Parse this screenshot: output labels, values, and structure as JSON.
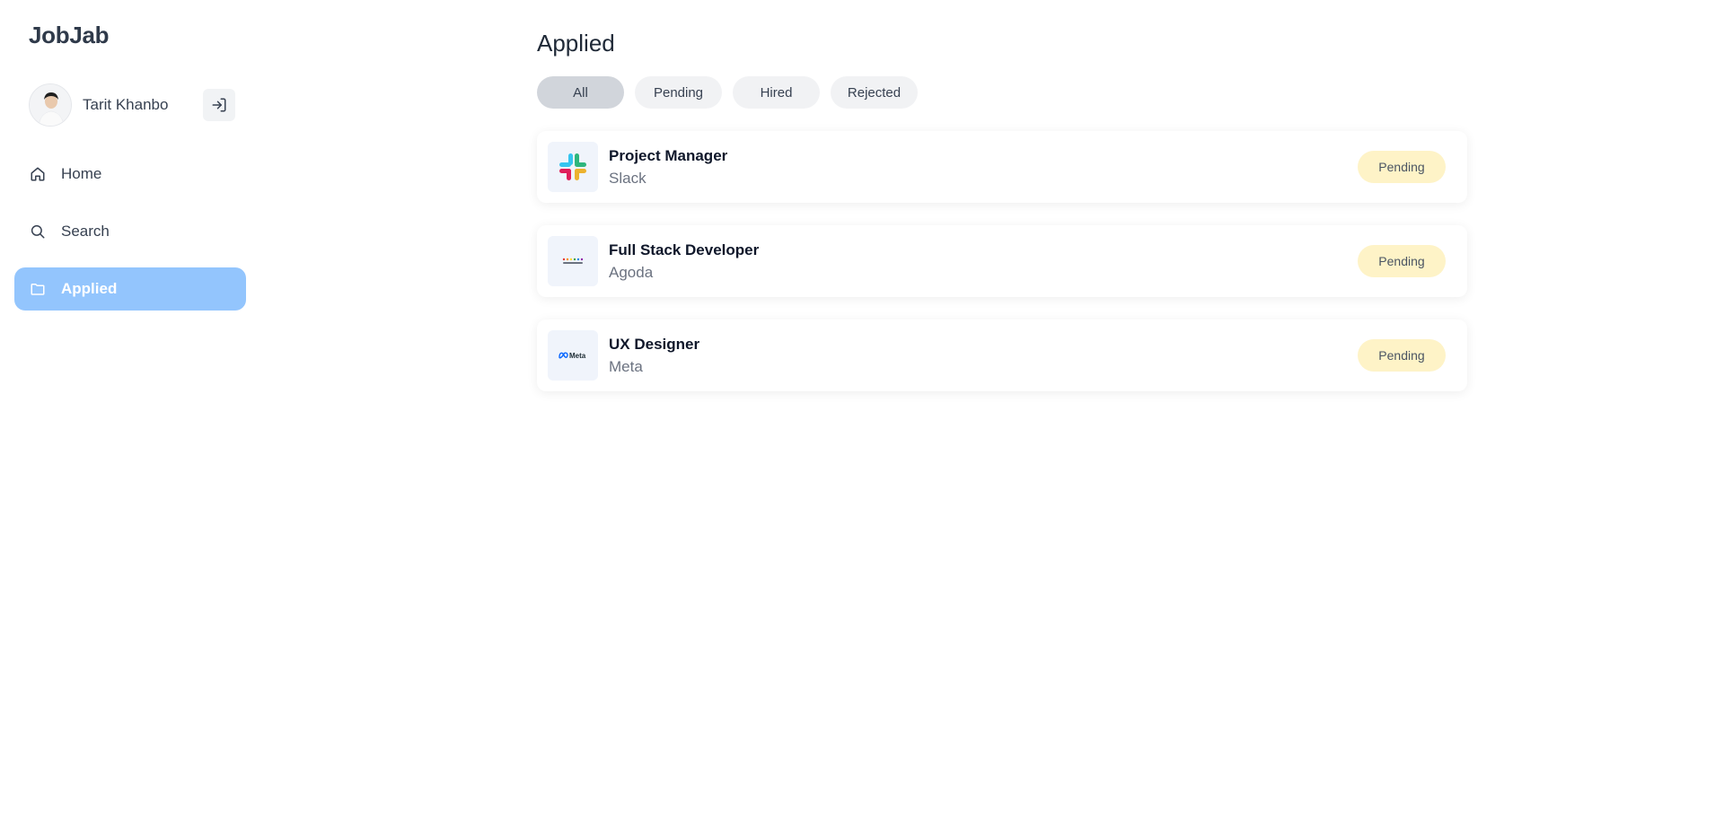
{
  "app": {
    "brand": "JobJab"
  },
  "user": {
    "name": "Tarit Khanbo"
  },
  "sidebar": {
    "items": [
      {
        "label": "Home",
        "icon": "home-icon",
        "active": false
      },
      {
        "label": "Search",
        "icon": "search-icon",
        "active": false
      },
      {
        "label": "Applied",
        "icon": "folder-icon",
        "active": true
      }
    ]
  },
  "main": {
    "title": "Applied",
    "filters": [
      {
        "label": "All",
        "active": true
      },
      {
        "label": "Pending",
        "active": false
      },
      {
        "label": "Hired",
        "active": false
      },
      {
        "label": "Rejected",
        "active": false
      }
    ],
    "jobs": [
      {
        "title": "Project Manager",
        "company": "Slack",
        "status": "Pending",
        "logo": "slack-logo"
      },
      {
        "title": "Full Stack Developer",
        "company": "Agoda",
        "status": "Pending",
        "logo": "agoda-logo"
      },
      {
        "title": "UX Designer",
        "company": "Meta",
        "status": "Pending",
        "logo": "meta-logo",
        "logo_text": "Meta"
      }
    ]
  },
  "colors": {
    "active_nav": "#93c5fd",
    "pending_badge": "#fef3c7",
    "active_chip": "#d1d5db"
  }
}
